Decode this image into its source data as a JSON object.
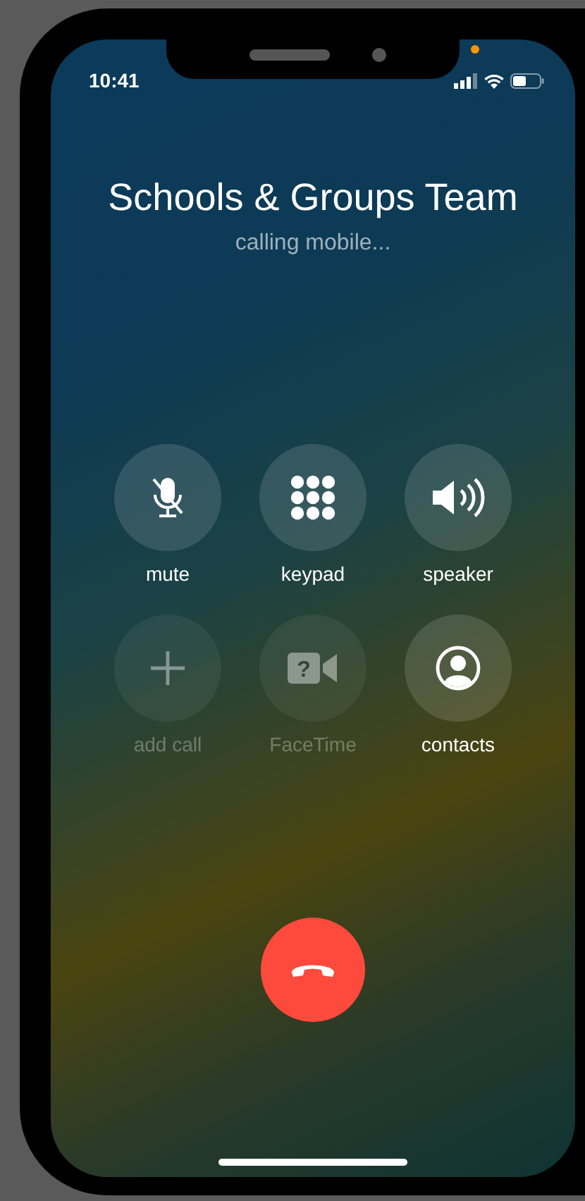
{
  "status_bar": {
    "time": "10:41"
  },
  "caller": {
    "name": "Schools & Groups Team",
    "status": "calling mobile..."
  },
  "controls": [
    {
      "label": "mute",
      "kind": "mute",
      "disabled": false
    },
    {
      "label": "keypad",
      "kind": "keypad",
      "disabled": false
    },
    {
      "label": "speaker",
      "kind": "speaker",
      "disabled": false
    },
    {
      "label": "add call",
      "kind": "add",
      "disabled": true
    },
    {
      "label": "FaceTime",
      "kind": "facetime",
      "disabled": true,
      "glyph": "?"
    },
    {
      "label": "contacts",
      "kind": "contacts",
      "disabled": false
    }
  ]
}
